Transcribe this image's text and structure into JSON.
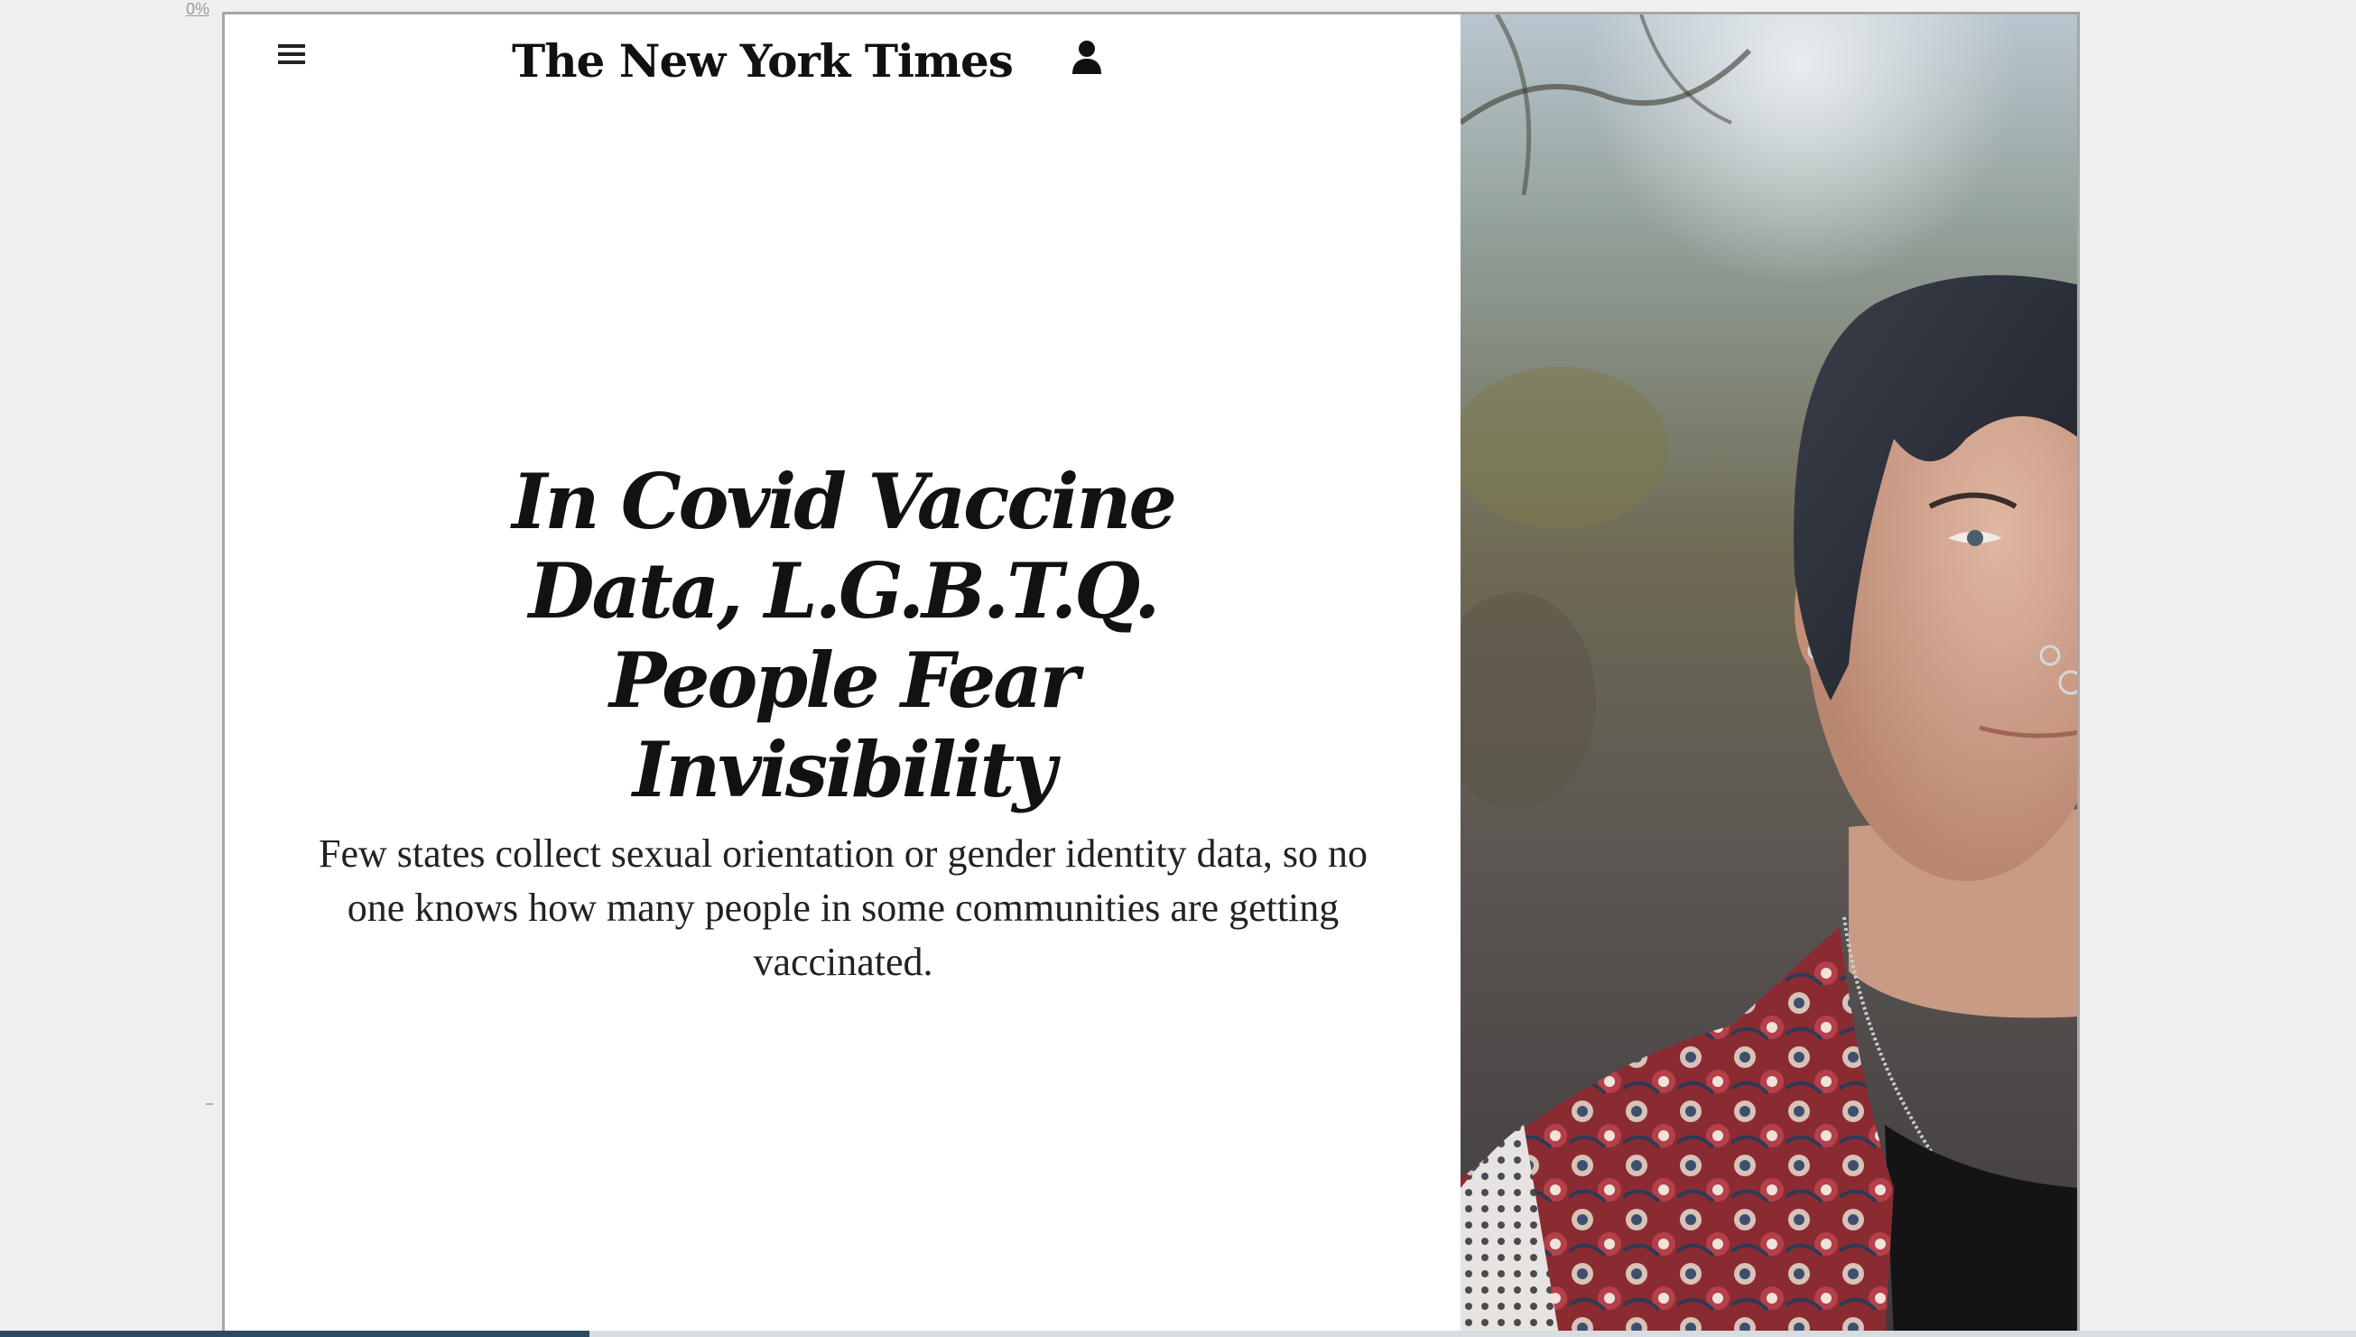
{
  "zoom": {
    "label": "0%"
  },
  "header": {
    "logo_text": "The New York Times",
    "menu_icon": "hamburger-menu-icon",
    "account_icon": "person-icon"
  },
  "article": {
    "headline": "In Covid Vaccine Data, L.G.B.T.Q. People Fear Invisibility",
    "summary": "Few states collect sexual orientation or gender identity data, so no one knows how many people in some communities are getting vaccinated."
  },
  "hero_image": {
    "icon": "portrait-photo"
  },
  "scroll_progress": {
    "fraction": 0.25
  },
  "colors": {
    "text": "#121212",
    "page_background": "#ffffff",
    "outer_background": "#efefef",
    "progress": "#2c4a63"
  }
}
